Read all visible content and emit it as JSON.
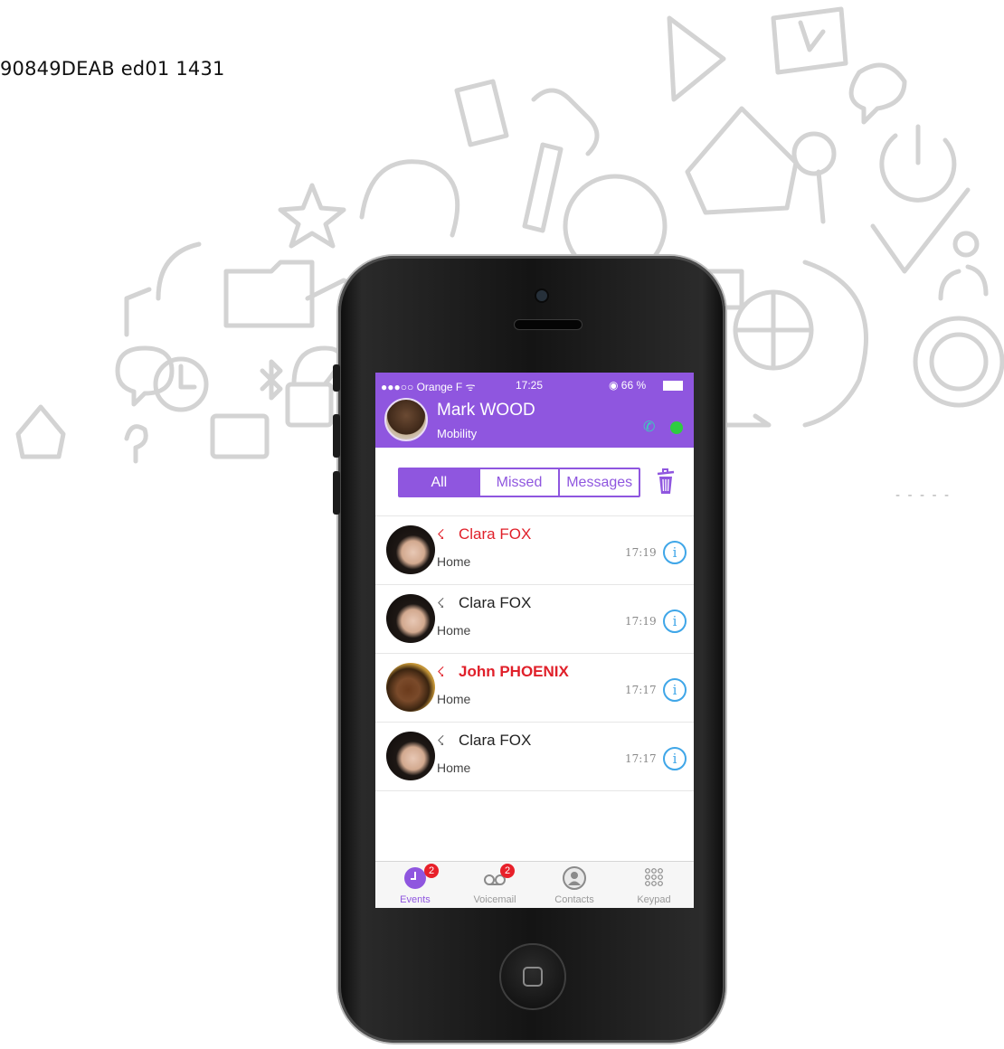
{
  "doc_ref": "90849DEAB ed01 1431",
  "colors": {
    "accent": "#8f56df",
    "missed": "#e0202a",
    "info": "#3fa6e8",
    "badge": "#e8202a"
  },
  "status_bar": {
    "carrier": "●●●○○ Orange F ᯤ",
    "time": "17:25",
    "battery": "◉ 66 %"
  },
  "profile": {
    "name": "Mark WOOD",
    "status": "Mobility"
  },
  "filters": {
    "all": "All",
    "missed": "Missed",
    "messages": "Messages",
    "selected": "All"
  },
  "calls": [
    {
      "name": "Clara FOX",
      "sub": "Home",
      "time": "17:19",
      "missed": true,
      "icon": "missed-call-icon"
    },
    {
      "name": "Clara FOX",
      "sub": "Home",
      "time": "17:19",
      "missed": false,
      "icon": "call-icon"
    },
    {
      "name": "John PHOENIX",
      "sub": "Home",
      "time": "17:17",
      "missed": true,
      "icon": "missed-call-icon"
    },
    {
      "name": "Clara FOX",
      "sub": "Home",
      "time": "17:17",
      "missed": false,
      "icon": "call-icon"
    }
  ],
  "tabs": {
    "events": {
      "label": "Events",
      "badge": "2"
    },
    "voicemail": {
      "label": "Voicemail",
      "badge": "2"
    },
    "contacts": {
      "label": "Contacts"
    },
    "keypad": {
      "label": "Keypad"
    }
  }
}
